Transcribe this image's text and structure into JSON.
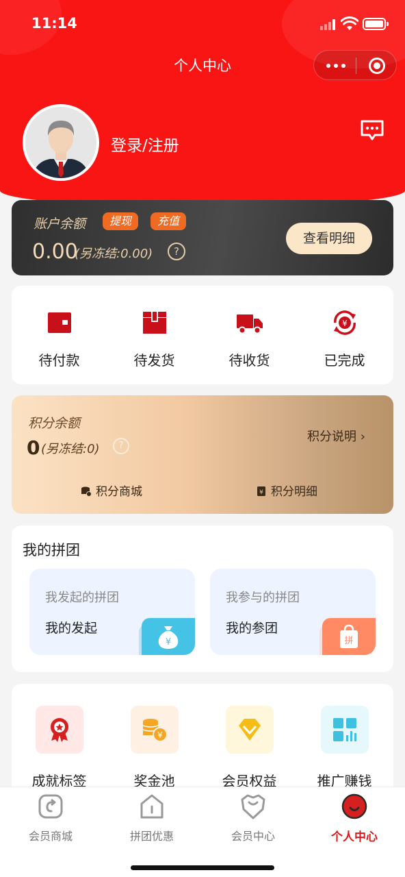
{
  "status_bar": {
    "time": "11:14"
  },
  "nav": {
    "title": "个人中心"
  },
  "profile": {
    "login_text": "登录/注册"
  },
  "balance": {
    "label": "账户余额",
    "withdraw_tag": "提现",
    "recharge_tag": "充值",
    "amount": "0.00",
    "frozen": "(另冻结:0.00)",
    "help": "?",
    "detail_button": "查看明细"
  },
  "orders": [
    {
      "label": "待付款",
      "icon": "wallet-icon"
    },
    {
      "label": "待发货",
      "icon": "package-icon"
    },
    {
      "label": "待收货",
      "icon": "truck-icon"
    },
    {
      "label": "已完成",
      "icon": "yuan-refresh-icon"
    }
  ],
  "points": {
    "label": "积分余额",
    "value": "0",
    "frozen": "(另冻结:0)",
    "help": "?",
    "explain": "积分说明 ›",
    "mall_link": "积分商城",
    "detail_link": "积分明细"
  },
  "group": {
    "title": "我的拼团",
    "cards": [
      {
        "subtitle": "我发起的拼团",
        "main": "我的发起",
        "icon": "money-bag-icon"
      },
      {
        "subtitle": "我参与的拼团",
        "main": "我的参团",
        "icon": "shopping-bag-icon"
      }
    ]
  },
  "tools": [
    {
      "label": "成就标签",
      "icon": "medal-icon"
    },
    {
      "label": "奖金池",
      "icon": "coins-icon"
    },
    {
      "label": "会员权益",
      "icon": "diamond-icon"
    },
    {
      "label": "推广赚钱",
      "icon": "grid-chart-icon"
    }
  ],
  "tabbar": [
    {
      "label": "会员商城",
      "active": false
    },
    {
      "label": "拼团优惠",
      "active": false
    },
    {
      "label": "会员中心",
      "active": false
    },
    {
      "label": "个人中心",
      "active": true
    }
  ],
  "colors": {
    "primary_red": "#fa1515",
    "accent_orange": "#ef6b24",
    "gold_text": "#f3dcb6"
  }
}
